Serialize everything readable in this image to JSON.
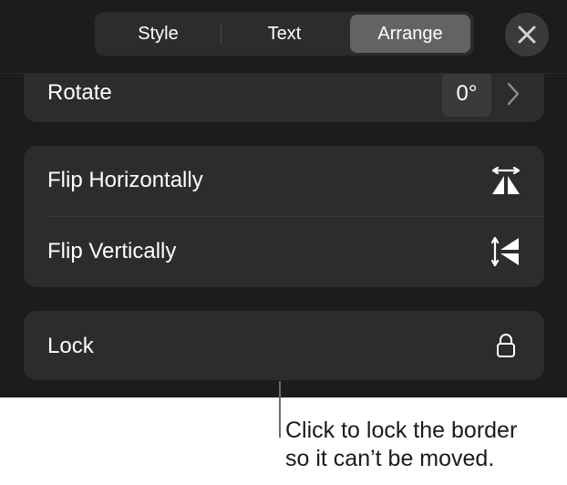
{
  "tabs": [
    {
      "label": "Style",
      "selected": false
    },
    {
      "label": "Text",
      "selected": false
    },
    {
      "label": "Arrange",
      "selected": true
    }
  ],
  "close_icon": "close-icon",
  "rotate": {
    "label": "Rotate",
    "value": "0°",
    "icon": "chevron-right-icon"
  },
  "flip": {
    "horizontal": {
      "label": "Flip Horizontally",
      "icon": "flip-horizontal-icon"
    },
    "vertical": {
      "label": "Flip Vertically",
      "icon": "flip-vertical-icon"
    }
  },
  "lock": {
    "label": "Lock",
    "icon": "lock-icon"
  },
  "callout": {
    "line1": "Click to lock the border",
    "line2": "so it can’t be moved."
  },
  "colors": {
    "panel_background": "#1c1c1e",
    "group_background": "#2c2c2e",
    "selected_tab": "#636366",
    "text": "#ffffff"
  }
}
